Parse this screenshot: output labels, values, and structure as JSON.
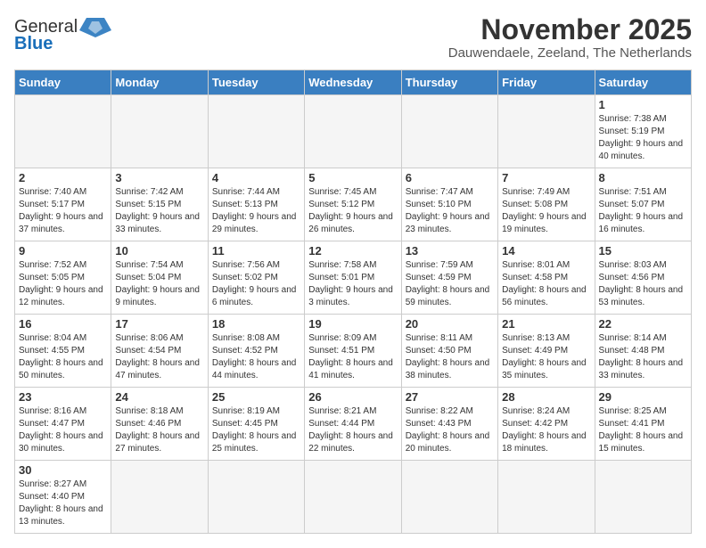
{
  "logo": {
    "line1": "General",
    "line2": "Blue"
  },
  "title": "November 2025",
  "subtitle": "Dauwendaele, Zeeland, The Netherlands",
  "weekdays": [
    "Sunday",
    "Monday",
    "Tuesday",
    "Wednesday",
    "Thursday",
    "Friday",
    "Saturday"
  ],
  "weeks": [
    [
      {
        "day": "",
        "info": ""
      },
      {
        "day": "",
        "info": ""
      },
      {
        "day": "",
        "info": ""
      },
      {
        "day": "",
        "info": ""
      },
      {
        "day": "",
        "info": ""
      },
      {
        "day": "",
        "info": ""
      },
      {
        "day": "1",
        "info": "Sunrise: 7:38 AM\nSunset: 5:19 PM\nDaylight: 9 hours and 40 minutes."
      }
    ],
    [
      {
        "day": "2",
        "info": "Sunrise: 7:40 AM\nSunset: 5:17 PM\nDaylight: 9 hours and 37 minutes."
      },
      {
        "day": "3",
        "info": "Sunrise: 7:42 AM\nSunset: 5:15 PM\nDaylight: 9 hours and 33 minutes."
      },
      {
        "day": "4",
        "info": "Sunrise: 7:44 AM\nSunset: 5:13 PM\nDaylight: 9 hours and 29 minutes."
      },
      {
        "day": "5",
        "info": "Sunrise: 7:45 AM\nSunset: 5:12 PM\nDaylight: 9 hours and 26 minutes."
      },
      {
        "day": "6",
        "info": "Sunrise: 7:47 AM\nSunset: 5:10 PM\nDaylight: 9 hours and 23 minutes."
      },
      {
        "day": "7",
        "info": "Sunrise: 7:49 AM\nSunset: 5:08 PM\nDaylight: 9 hours and 19 minutes."
      },
      {
        "day": "8",
        "info": "Sunrise: 7:51 AM\nSunset: 5:07 PM\nDaylight: 9 hours and 16 minutes."
      }
    ],
    [
      {
        "day": "9",
        "info": "Sunrise: 7:52 AM\nSunset: 5:05 PM\nDaylight: 9 hours and 12 minutes."
      },
      {
        "day": "10",
        "info": "Sunrise: 7:54 AM\nSunset: 5:04 PM\nDaylight: 9 hours and 9 minutes."
      },
      {
        "day": "11",
        "info": "Sunrise: 7:56 AM\nSunset: 5:02 PM\nDaylight: 9 hours and 6 minutes."
      },
      {
        "day": "12",
        "info": "Sunrise: 7:58 AM\nSunset: 5:01 PM\nDaylight: 9 hours and 3 minutes."
      },
      {
        "day": "13",
        "info": "Sunrise: 7:59 AM\nSunset: 4:59 PM\nDaylight: 8 hours and 59 minutes."
      },
      {
        "day": "14",
        "info": "Sunrise: 8:01 AM\nSunset: 4:58 PM\nDaylight: 8 hours and 56 minutes."
      },
      {
        "day": "15",
        "info": "Sunrise: 8:03 AM\nSunset: 4:56 PM\nDaylight: 8 hours and 53 minutes."
      }
    ],
    [
      {
        "day": "16",
        "info": "Sunrise: 8:04 AM\nSunset: 4:55 PM\nDaylight: 8 hours and 50 minutes."
      },
      {
        "day": "17",
        "info": "Sunrise: 8:06 AM\nSunset: 4:54 PM\nDaylight: 8 hours and 47 minutes."
      },
      {
        "day": "18",
        "info": "Sunrise: 8:08 AM\nSunset: 4:52 PM\nDaylight: 8 hours and 44 minutes."
      },
      {
        "day": "19",
        "info": "Sunrise: 8:09 AM\nSunset: 4:51 PM\nDaylight: 8 hours and 41 minutes."
      },
      {
        "day": "20",
        "info": "Sunrise: 8:11 AM\nSunset: 4:50 PM\nDaylight: 8 hours and 38 minutes."
      },
      {
        "day": "21",
        "info": "Sunrise: 8:13 AM\nSunset: 4:49 PM\nDaylight: 8 hours and 35 minutes."
      },
      {
        "day": "22",
        "info": "Sunrise: 8:14 AM\nSunset: 4:48 PM\nDaylight: 8 hours and 33 minutes."
      }
    ],
    [
      {
        "day": "23",
        "info": "Sunrise: 8:16 AM\nSunset: 4:47 PM\nDaylight: 8 hours and 30 minutes."
      },
      {
        "day": "24",
        "info": "Sunrise: 8:18 AM\nSunset: 4:46 PM\nDaylight: 8 hours and 27 minutes."
      },
      {
        "day": "25",
        "info": "Sunrise: 8:19 AM\nSunset: 4:45 PM\nDaylight: 8 hours and 25 minutes."
      },
      {
        "day": "26",
        "info": "Sunrise: 8:21 AM\nSunset: 4:44 PM\nDaylight: 8 hours and 22 minutes."
      },
      {
        "day": "27",
        "info": "Sunrise: 8:22 AM\nSunset: 4:43 PM\nDaylight: 8 hours and 20 minutes."
      },
      {
        "day": "28",
        "info": "Sunrise: 8:24 AM\nSunset: 4:42 PM\nDaylight: 8 hours and 18 minutes."
      },
      {
        "day": "29",
        "info": "Sunrise: 8:25 AM\nSunset: 4:41 PM\nDaylight: 8 hours and 15 minutes."
      }
    ],
    [
      {
        "day": "30",
        "info": "Sunrise: 8:27 AM\nSunset: 4:40 PM\nDaylight: 8 hours and 13 minutes."
      },
      {
        "day": "",
        "info": ""
      },
      {
        "day": "",
        "info": ""
      },
      {
        "day": "",
        "info": ""
      },
      {
        "day": "",
        "info": ""
      },
      {
        "day": "",
        "info": ""
      },
      {
        "day": "",
        "info": ""
      }
    ]
  ]
}
